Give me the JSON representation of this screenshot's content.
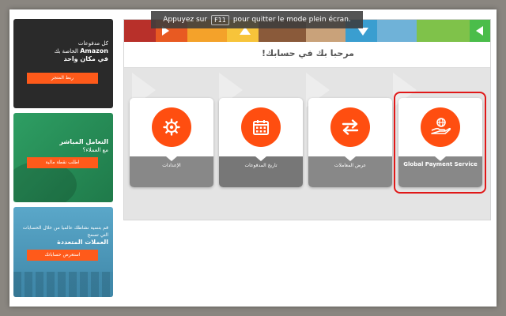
{
  "fullscreen_hint": {
    "before": "Appuyez sur",
    "key": "F11",
    "after": "pour quitter le mode plein écran."
  },
  "welcome_title": "مرحبا بك في حسابك!",
  "promos": [
    {
      "line1": "كل مدفوعات",
      "line2": "Amazon",
      "line3": "الخاصة بك",
      "line4": "في مكان واحد",
      "button": "ربط المتجر"
    },
    {
      "line1": "التعامل المباشر",
      "line2": "مع العملاء؟",
      "button": "اطلب نقطة مالية"
    },
    {
      "line1": "قم بتنمية نشاطك عالميا من خلال الحسابات",
      "line2": "التي تسمح",
      "line3": "العملات المتعددة",
      "button": "استعرض حساباتك"
    }
  ],
  "cards": [
    {
      "label": "الإعدادات",
      "icon": "gear-icon"
    },
    {
      "label": "تاريخ المدفوعات",
      "icon": "calendar-icon"
    },
    {
      "label": "عرض المعاملات",
      "icon": "exchange-arrows-icon"
    },
    {
      "label": "Global Payment Service",
      "icon": "globe-hand-icon"
    }
  ],
  "colors": {
    "accent": "#ff4e10",
    "highlight": "#e01818",
    "card_label_bg": "#888888",
    "green_tab": "#4bbd4a"
  }
}
